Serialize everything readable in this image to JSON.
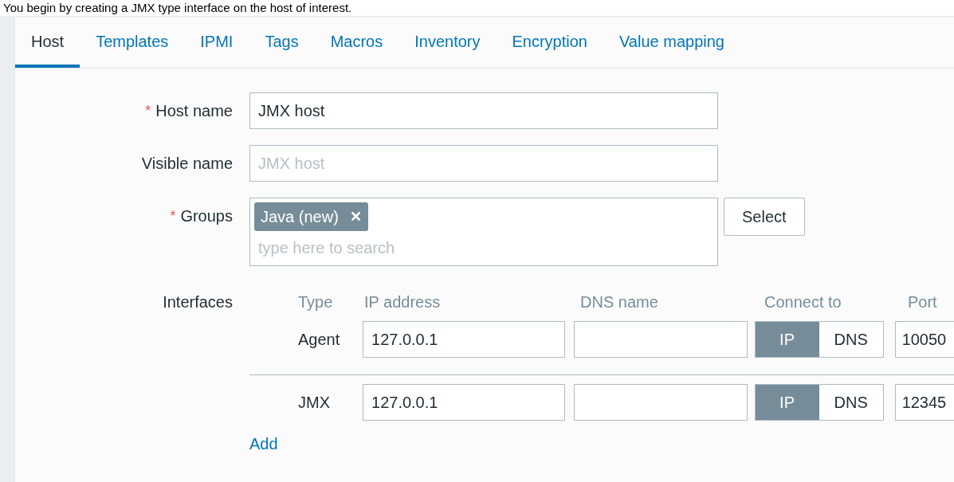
{
  "caption": "You begin by creating a JMX type interface on the host of interest.",
  "tabs": [
    {
      "label": "Host",
      "selected": true
    },
    {
      "label": "Templates",
      "selected": false
    },
    {
      "label": "IPMI",
      "selected": false
    },
    {
      "label": "Tags",
      "selected": false
    },
    {
      "label": "Macros",
      "selected": false
    },
    {
      "label": "Inventory",
      "selected": false
    },
    {
      "label": "Encryption",
      "selected": false
    },
    {
      "label": "Value mapping",
      "selected": false
    }
  ],
  "host_name": {
    "required_mark": "*",
    "label": "Host name",
    "value": "JMX host"
  },
  "visible_name": {
    "label": "Visible name",
    "placeholder": "JMX host"
  },
  "groups": {
    "required_mark": "*",
    "label": "Groups",
    "tags": [
      "Java (new)"
    ],
    "remove_symbol": "✕",
    "placeholder": "type here to search",
    "button": "Select"
  },
  "interfaces": {
    "label": "Interfaces",
    "columns": [
      "Type",
      "IP address",
      "DNS name",
      "Connect to",
      "Port"
    ],
    "rows": [
      {
        "type": "Agent",
        "ip": "127.0.0.1",
        "dns": "",
        "connect": [
          {
            "label": "IP",
            "selected": true
          },
          {
            "label": "DNS",
            "selected": false
          }
        ],
        "port": "10050"
      },
      {
        "type": "JMX",
        "ip": "127.0.0.1",
        "dns": "",
        "connect": [
          {
            "label": "IP",
            "selected": true
          },
          {
            "label": "DNS",
            "selected": false
          }
        ],
        "port": "12345"
      }
    ],
    "add_link": "Add"
  }
}
